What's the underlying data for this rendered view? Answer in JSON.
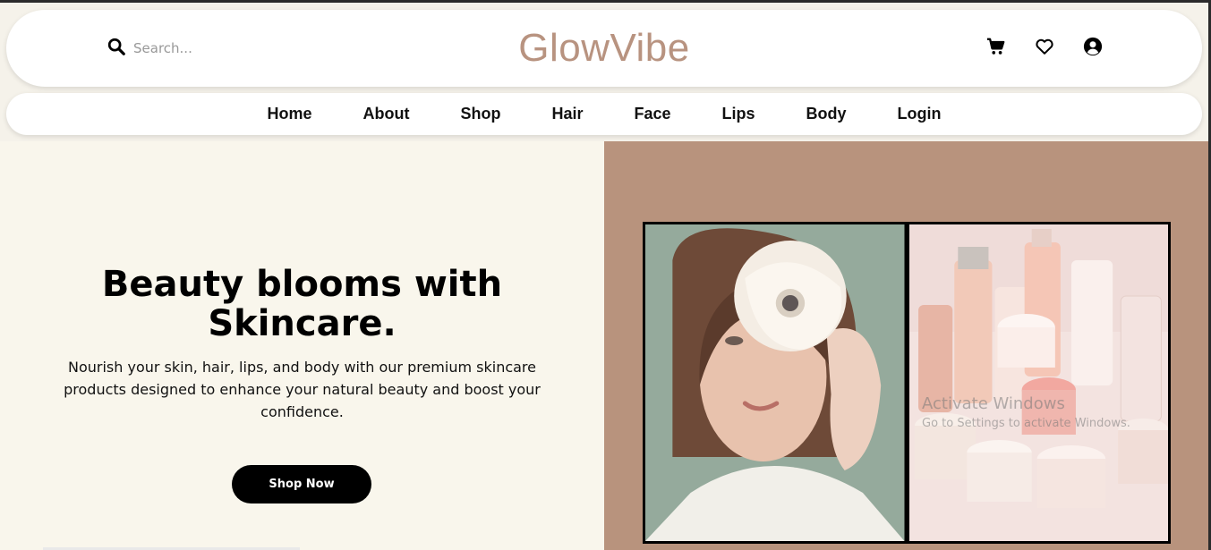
{
  "header": {
    "brand": "GlowVibe",
    "search": {
      "placeholder": "Search..."
    },
    "icons": [
      "cart-icon",
      "heart-icon",
      "user-icon"
    ]
  },
  "nav": {
    "items": [
      "Home",
      "About",
      "Shop",
      "Hair",
      "Face",
      "Lips",
      "Body",
      "Login"
    ]
  },
  "hero": {
    "title_line1": "Beauty blooms with",
    "title_line2": "Skincare.",
    "description": "Nourish your skin, hair, lips, and body with our premium skincare products designed to enhance your natural beauty and boost your confidence.",
    "cta": "Shop Now"
  },
  "watermark": {
    "line1": "Activate Windows",
    "line2": "Go to Settings to activate Windows."
  },
  "colors": {
    "brand": "#b89380",
    "hero_left_bg": "#f9f6ec",
    "hero_right_bg": "#b8937d",
    "button": "#000000"
  }
}
